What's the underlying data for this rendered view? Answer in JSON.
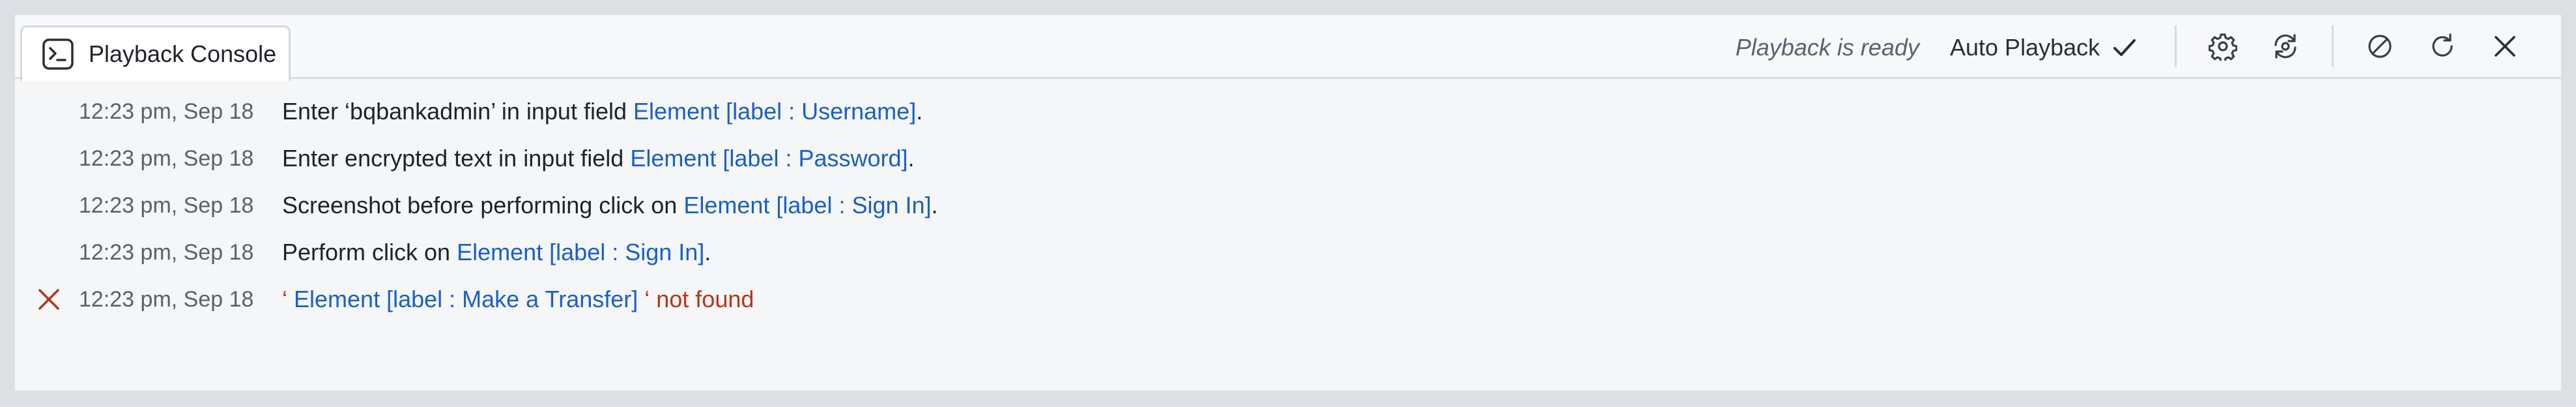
{
  "tab": {
    "label": "Playback Console",
    "icon": "terminal-icon"
  },
  "toolbar": {
    "status": "Playback is ready",
    "auto_playback_label": "Auto Playback",
    "icons": [
      "check-icon",
      "settings-gear-icon",
      "sync-refresh-icon",
      "stop-circle-icon",
      "reload-icon",
      "close-icon"
    ]
  },
  "colors": {
    "link": "#1a5fc6",
    "error": "#b5361b",
    "timestamp": "#5b616b"
  },
  "log": [
    {
      "time": "12:23 pm, Sep 18",
      "pre": "Enter ‘bqbankadmin’ in input field ",
      "link": "Element [label : Username]",
      "post": ".",
      "status": "ok"
    },
    {
      "time": "12:23 pm, Sep 18",
      "pre": "Enter encrypted text in input field ",
      "link": "Element [label : Password]",
      "post": ".",
      "status": "ok"
    },
    {
      "time": "12:23 pm, Sep 18",
      "pre": "Screenshot before performing click on ",
      "link": "Element [label : Sign In]",
      "post": ".",
      "status": "ok"
    },
    {
      "time": "12:23 pm, Sep 18",
      "pre": "Perform click on ",
      "link": "Element [label : Sign In]",
      "post": ".",
      "status": "ok"
    },
    {
      "time": "12:23 pm, Sep 18",
      "pre": "‘ ",
      "link": "Element [label : Make a Transfer]",
      "post": " ‘ not found",
      "status": "error"
    }
  ]
}
